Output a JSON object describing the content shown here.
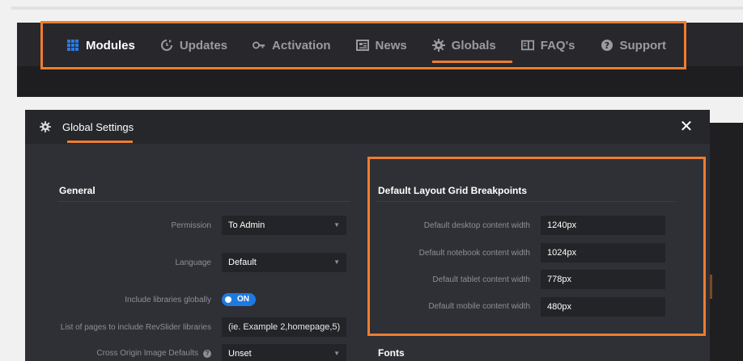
{
  "nav": {
    "items": [
      {
        "label": "Modules",
        "icon": "grid-icon",
        "active": true
      },
      {
        "label": "Updates",
        "icon": "refresh-icon"
      },
      {
        "label": "Activation",
        "icon": "key-icon"
      },
      {
        "label": "News",
        "icon": "newspaper-icon"
      },
      {
        "label": "Globals",
        "icon": "gear-icon",
        "underline": true
      },
      {
        "label": "FAQ's",
        "icon": "book-icon"
      },
      {
        "label": "Support",
        "icon": "question-circle-icon"
      }
    ]
  },
  "modal": {
    "title": "Global Settings",
    "icon": "gear-icon",
    "close_icon": "close-icon",
    "general": {
      "title": "General",
      "permission": {
        "label": "Permission",
        "value": "To Admin"
      },
      "language": {
        "label": "Language",
        "value": "Default"
      },
      "include_libraries": {
        "label": "Include libraries globally",
        "value": "ON"
      },
      "pages_list": {
        "label": "List of pages to include RevSlider libraries",
        "placeholder": "(ie. Example 2,homepage,5)"
      },
      "cross_origin": {
        "label": "Cross Origin Image Defaults",
        "value": "Unset"
      }
    },
    "breakpoints": {
      "title": "Default Layout Grid Breakpoints",
      "desktop": {
        "label": "Default desktop content width",
        "value": "1240px"
      },
      "notebook": {
        "label": "Default notebook content width",
        "value": "1024px"
      },
      "tablet": {
        "label": "Default tablet content width",
        "value": "778px"
      },
      "mobile": {
        "label": "Default mobile content width",
        "value": "480px"
      }
    },
    "fonts": {
      "title": "Fonts"
    }
  },
  "colors": {
    "accent": "#ed7d31",
    "toggle_blue": "#1f7ae0",
    "active_icon": "#2b7be0"
  }
}
